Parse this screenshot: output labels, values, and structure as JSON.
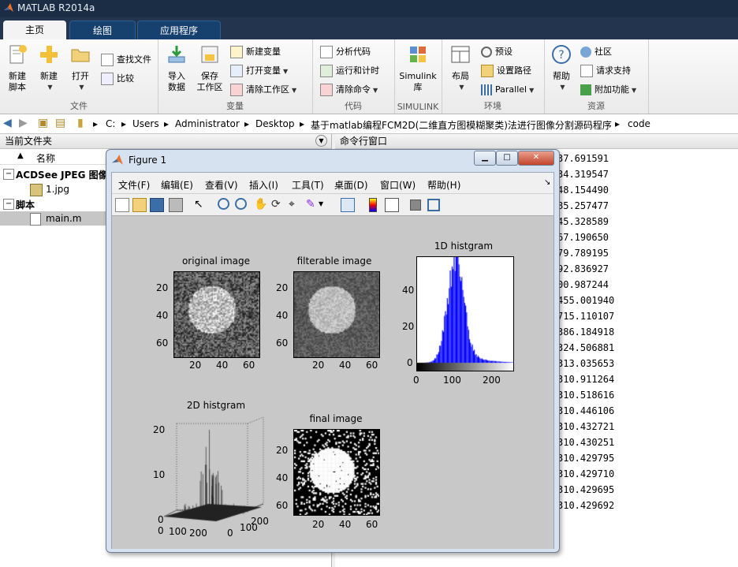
{
  "window": {
    "title": "MATLAB R2014a"
  },
  "tabs": [
    {
      "label": "主页",
      "active": true
    },
    {
      "label": "绘图",
      "active": false
    },
    {
      "label": "应用程序",
      "active": false
    }
  ],
  "ribbon": {
    "file_group": {
      "label": "文件",
      "new_script": "新建\n脚本",
      "new": "新建",
      "open": "打开",
      "find_files": "查找文件",
      "compare": "比较"
    },
    "variable_group": {
      "label": "变量",
      "import": "导入\n数据",
      "save_workspace": "保存\n工作区",
      "new_variable": "新建变量",
      "open_variable": "打开变量",
      "clear_workspace": "清除工作区"
    },
    "code_group": {
      "label": "代码",
      "analyze": "分析代码",
      "run_time": "运行和计时",
      "clear_commands": "清除命令"
    },
    "simulink_group": {
      "label": "SIMULINK",
      "library": "Simulink\n库"
    },
    "env_group": {
      "label": "环境",
      "layout": "布局",
      "prefs": "预设",
      "set_path": "设置路径",
      "parallel": "Parallel"
    },
    "resources_group": {
      "label": "资源",
      "help": "帮助",
      "community": "社区",
      "request_support": "请求支持",
      "addons": "附加功能"
    }
  },
  "address": {
    "crumbs": [
      "C:",
      "Users",
      "Administrator",
      "Desktop",
      "基于matlab编程FCM2D(二维直方图模糊聚类)法进行图像分割源码程序",
      "code"
    ]
  },
  "current_folder": {
    "title": "当前文件夹",
    "column": "名称",
    "tree": [
      {
        "label": "ACDSee JPEG 图像",
        "type": "group"
      },
      {
        "label": "1.jpg",
        "type": "file"
      },
      {
        "label": "脚本",
        "type": "group"
      },
      {
        "label": "main.m",
        "type": "file",
        "selected": true
      }
    ]
  },
  "command_window": {
    "title": "命令行窗口",
    "lines": [
      "37.691591",
      "34.319547",
      "48.154490",
      "85.257477",
      "45.328589",
      "67.190650",
      "79.789195",
      "92.836927",
      "00.987244",
      "455.001940",
      "715.110107",
      "386.184918",
      "324.506881",
      "313.035653",
      "310.911264",
      "310.518616",
      "310.446106",
      "310.432721",
      "310.430251",
      "310.429795",
      "310.429710",
      "310.429695",
      "310.429692"
    ]
  },
  "figure": {
    "title": "Figure 1",
    "menus": [
      "文件(F)",
      "编辑(E)",
      "查看(V)",
      "插入(I)",
      "工具(T)",
      "桌面(D)",
      "窗口(W)",
      "帮助(H)"
    ],
    "plots": {
      "original": {
        "title": "original image",
        "yticks": [
          "20",
          "40",
          "60"
        ],
        "xticks": [
          "20",
          "40",
          "60"
        ]
      },
      "filterable": {
        "title": "filterable image",
        "yticks": [
          "20",
          "40",
          "60"
        ],
        "xticks": [
          "20",
          "40",
          "60"
        ]
      },
      "hist1d": {
        "title": "1D histgram",
        "yticks": [
          "40",
          "20",
          "0"
        ],
        "xticks": [
          "0",
          "100",
          "200"
        ]
      },
      "hist2d": {
        "title": "2D histgram",
        "zticks": [
          "20",
          "10",
          "0"
        ],
        "xticks": [
          "0",
          "100",
          "200"
        ],
        "yticks": [
          "0",
          "100",
          "200"
        ]
      },
      "final": {
        "title": "final image",
        "yticks": [
          "20",
          "40",
          "60"
        ],
        "xticks": [
          "20",
          "40",
          "60"
        ]
      }
    }
  }
}
